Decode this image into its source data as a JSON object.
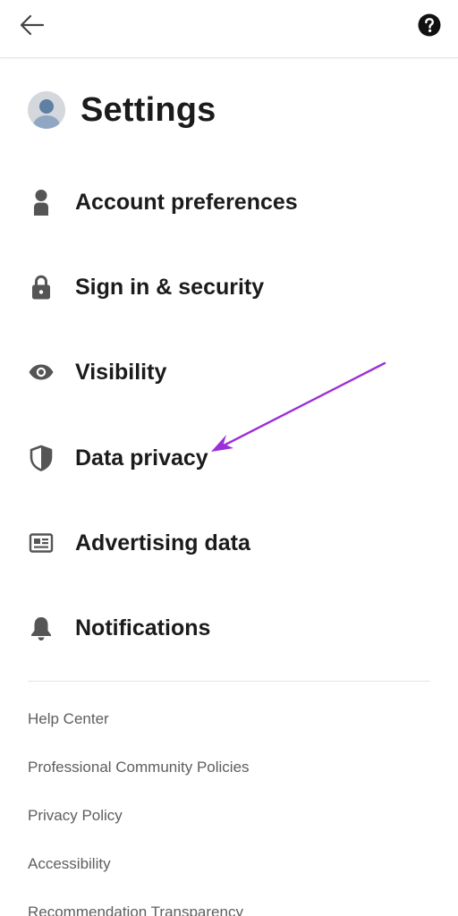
{
  "header": {
    "back_icon": "arrow-left-icon",
    "help_icon": "question-circle-icon",
    "title": "Settings"
  },
  "menu": {
    "items": [
      {
        "label": "Account preferences",
        "icon": "person-icon"
      },
      {
        "label": "Sign in & security",
        "icon": "lock-icon"
      },
      {
        "label": "Visibility",
        "icon": "eye-icon"
      },
      {
        "label": "Data privacy",
        "icon": "shield-icon"
      },
      {
        "label": "Advertising data",
        "icon": "newspaper-icon"
      },
      {
        "label": "Notifications",
        "icon": "bell-icon"
      }
    ]
  },
  "footer": {
    "links": [
      {
        "label": "Help Center"
      },
      {
        "label": "Professional Community Policies"
      },
      {
        "label": "Privacy Policy"
      },
      {
        "label": "Accessibility"
      },
      {
        "label": "Recommendation Transparency"
      }
    ]
  },
  "colors": {
    "text_primary": "#1b1b1b",
    "text_secondary": "#5e5e5e",
    "icon": "#555555",
    "annotation_arrow": "#9b30d9"
  }
}
